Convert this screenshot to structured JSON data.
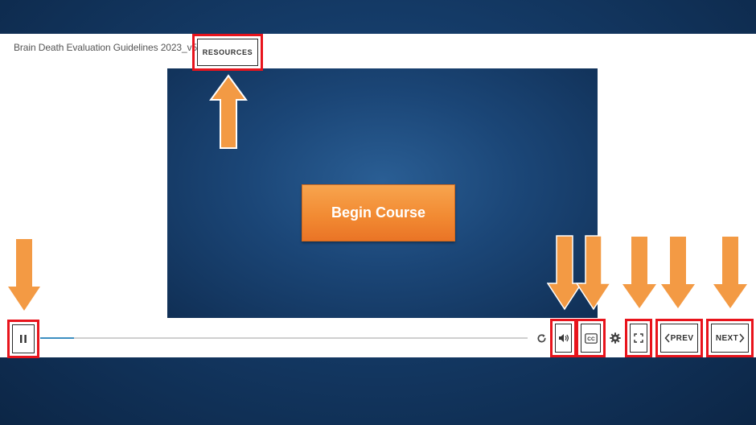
{
  "course": {
    "title": "Brain Death Evaluation Guidelines 2023_v5"
  },
  "toolbar": {
    "resources_label": "RESOURCES"
  },
  "slide": {
    "begin_label": "Begin Course"
  },
  "player": {
    "progress": 0.07,
    "prev_label": "PREV",
    "next_label": "NEXT",
    "cc_label": "CC"
  },
  "icons": {
    "pause": "pause-icon",
    "replay": "replay-icon",
    "volume": "volume-icon",
    "captions": "closed-captions-icon",
    "settings": "gear-icon",
    "fullscreen": "fullscreen-icon",
    "prev": "chevron-left-icon",
    "next": "chevron-right-icon",
    "annotation": "arrow-icon"
  },
  "colors": {
    "highlight": "#e8141c",
    "arrow": "#f39a44",
    "begin_button": "#f28b33",
    "progress": "#3d8fc1",
    "background": "#143a66"
  }
}
